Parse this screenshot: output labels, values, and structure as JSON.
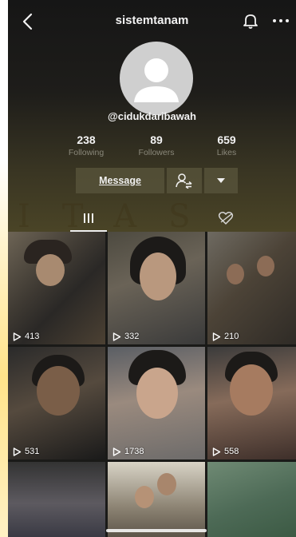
{
  "header": {
    "title": "sistemtanam"
  },
  "profile": {
    "handle": "@cidukdaribawah",
    "stats": [
      {
        "value": "238",
        "label": "Following"
      },
      {
        "value": "89",
        "label": "Followers"
      },
      {
        "value": "659",
        "label": "Likes"
      }
    ],
    "message_label": "Message"
  },
  "icons": {
    "back": "chevron-left-icon",
    "bell": "bell-icon",
    "more": "more-dots-icon",
    "avatar": "default-avatar-icon",
    "follow": "user-swap-icon",
    "dropdown": "caret-down-icon",
    "videos_tab": "grid-bars-icon",
    "liked_tab": "heart-hidden-icon",
    "play": "play-outline-icon"
  },
  "videos": [
    {
      "views": "413"
    },
    {
      "views": "332"
    },
    {
      "views": "210"
    },
    {
      "views": "531"
    },
    {
      "views": "1738"
    },
    {
      "views": "558"
    },
    {
      "views": ""
    },
    {
      "views": ""
    },
    {
      "views": ""
    }
  ],
  "colors": {
    "background": "#1a1a18",
    "text_primary": "#f2f2f2",
    "text_secondary": "#8a887a",
    "button_bg": "#5a563c"
  }
}
